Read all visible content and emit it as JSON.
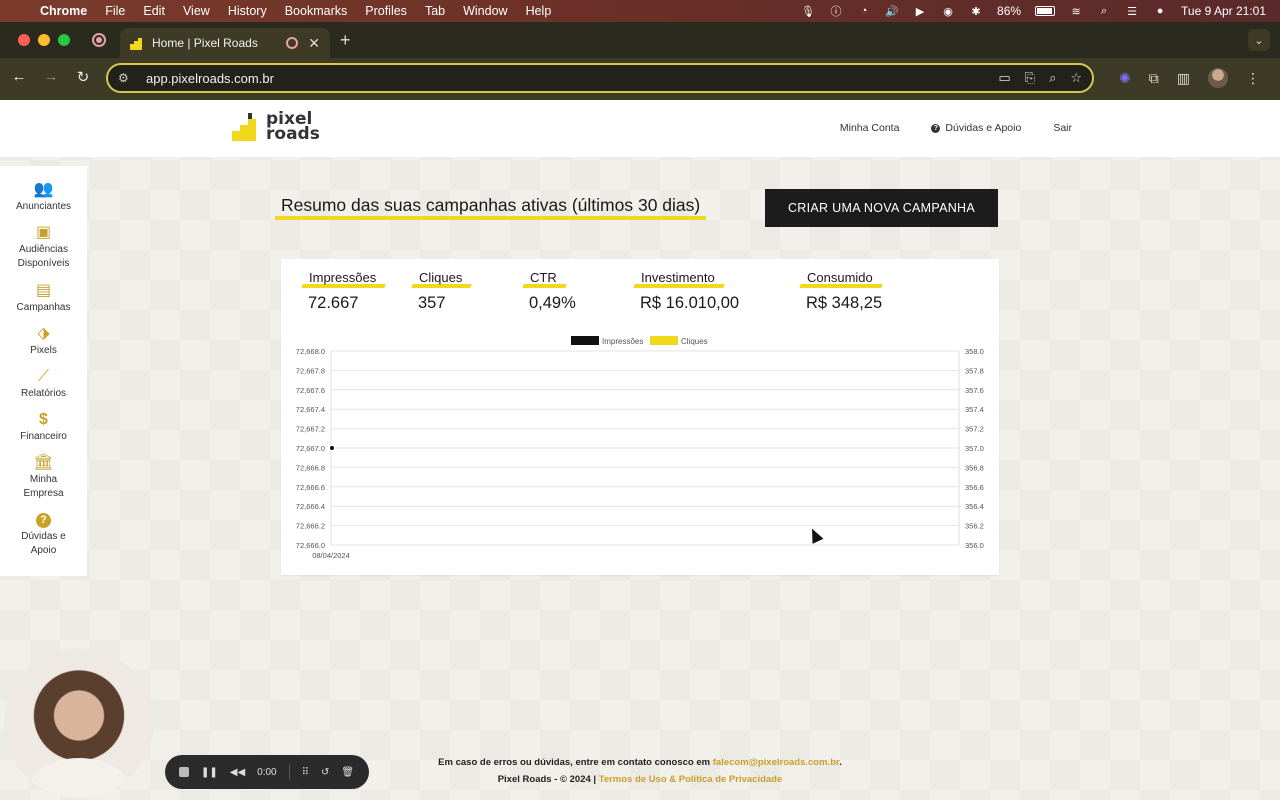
{
  "menubar": {
    "app": "Chrome",
    "items": [
      "File",
      "Edit",
      "View",
      "History",
      "Bookmarks",
      "Profiles",
      "Tab",
      "Window",
      "Help"
    ],
    "battery": "86%",
    "clock": "Tue 9 Apr  21:01"
  },
  "browser": {
    "tab_title": "Home | Pixel Roads",
    "url": "app.pixelroads.com.br"
  },
  "site": {
    "logo_line1": "pixel",
    "logo_line2": "roads",
    "header_links": {
      "account": "Minha Conta",
      "help": "Dúvidas e Apoio",
      "logout": "Sair"
    },
    "sidebar": [
      {
        "label": "Anunciantes",
        "icon": "users-icon"
      },
      {
        "label": "Audiências Disponíveis",
        "icon": "audience-icon"
      },
      {
        "label": "Campanhas",
        "icon": "document-icon"
      },
      {
        "label": "Pixels",
        "icon": "tag-icon"
      },
      {
        "label": "Relatórios",
        "icon": "line-chart-icon"
      },
      {
        "label": "Financeiro",
        "icon": "dollar-icon"
      },
      {
        "label": "Minha Empresa",
        "icon": "bank-icon"
      },
      {
        "label": "Dúvidas e Apoio",
        "icon": "question-icon"
      }
    ],
    "headline": "Resumo das suas campanhas ativas (últimos 30 dias)",
    "cta": "CRIAR UMA NOVA CAMPANHA",
    "kpis": [
      {
        "label": "Impressões",
        "value": "72.667"
      },
      {
        "label": "Cliques",
        "value": "357"
      },
      {
        "label": "CTR",
        "value": "0,49%"
      },
      {
        "label": "Investimento",
        "value": "R$ 16.010,00"
      },
      {
        "label": "Consumido",
        "value": "R$ 348,25"
      }
    ],
    "footer": {
      "line1_prefix": "Em caso de erros ou dúvidas, entre em contato conosco em ",
      "email": "falecom@pixelroads.com.br",
      "line1_suffix": ".",
      "line2_prefix": "Pixel Roads - © 2024 | ",
      "terms": "Termos de Uso & Política de Privacidade"
    }
  },
  "recorder": {
    "time": "0:00"
  },
  "colors": {
    "accent": "#f2d81a",
    "dark": "#1c1c1c",
    "impressions": "#111111",
    "clicks": "#f2d81a"
  },
  "chart_data": {
    "type": "line",
    "x": [
      "08/04/2024"
    ],
    "series": [
      {
        "name": "Impressões",
        "axis": "left",
        "values": [
          72667.0
        ]
      },
      {
        "name": "Cliques",
        "axis": "right",
        "values": [
          357.0
        ]
      }
    ],
    "y_left": {
      "min": 72666.0,
      "max": 72668.0,
      "ticks": [
        "72,668.0",
        "72,667.8",
        "72,667.6",
        "72,667.4",
        "72,667.2",
        "72,667.0",
        "72,666.8",
        "72,666.6",
        "72,666.4",
        "72,666.2",
        "72,666.0"
      ]
    },
    "y_right": {
      "min": 356.0,
      "max": 358.0,
      "ticks": [
        "358.0",
        "357.8",
        "357.6",
        "357.4",
        "357.2",
        "357.0",
        "356.8",
        "356.6",
        "356.4",
        "356.2",
        "356.0"
      ]
    },
    "legend": "top-center",
    "grid": true
  }
}
